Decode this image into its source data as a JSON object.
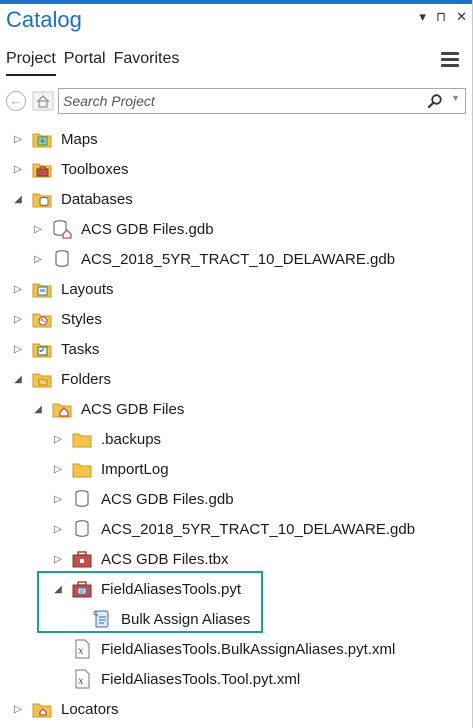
{
  "panel": {
    "title": "Catalog",
    "controls": [
      "▾",
      "⊓",
      "✕"
    ]
  },
  "tabs": [
    {
      "label": "Project",
      "active": true
    },
    {
      "label": "Portal",
      "active": false
    },
    {
      "label": "Favorites",
      "active": false
    }
  ],
  "search": {
    "placeholder": "Search Project",
    "value": ""
  },
  "tree": {
    "maps": "Maps",
    "toolboxes": "Toolboxes",
    "databases": "Databases",
    "db_acs_gdb": "ACS GDB Files.gdb",
    "db_acs_2018": "ACS_2018_5YR_TRACT_10_DELAWARE.gdb",
    "layouts": "Layouts",
    "styles": "Styles",
    "tasks": "Tasks",
    "folders": "Folders",
    "folder_acs": "ACS GDB Files",
    "backups": ".backups",
    "importlog": "ImportLog",
    "f_acs_gdb": "ACS GDB Files.gdb",
    "f_acs_2018": "ACS_2018_5YR_TRACT_10_DELAWARE.gdb",
    "f_acs_tbx": "ACS GDB Files.tbx",
    "pyt": "FieldAliasesTools.pyt",
    "bulk": "Bulk Assign Aliases",
    "xml1": "FieldAliasesTools.BulkAssignAliases.pyt.xml",
    "xml2": "FieldAliasesTools.Tool.pyt.xml",
    "locators": "Locators"
  },
  "colors": {
    "accent": "#1a73c8",
    "title": "#1f6fbf",
    "highlight_border": "#20a08a",
    "folder": "#f2c44e",
    "toolbox": "#c0504d"
  }
}
